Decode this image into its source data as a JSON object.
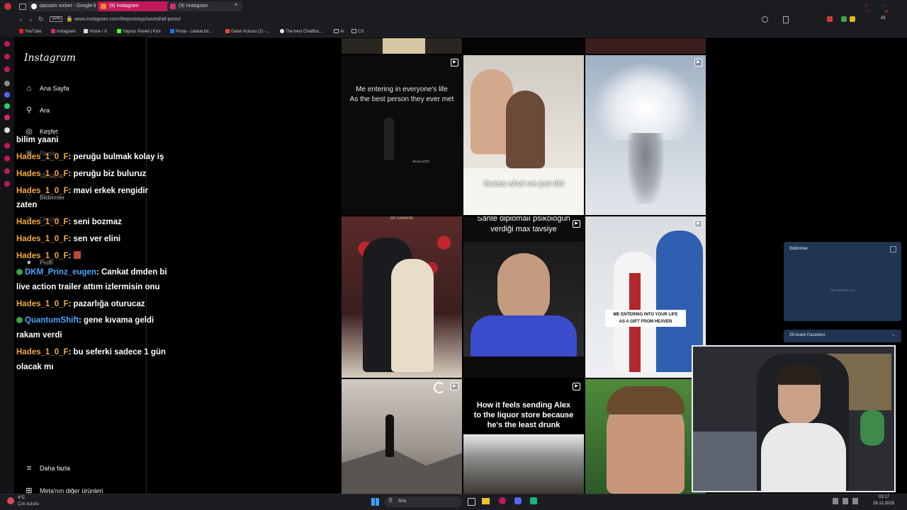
{
  "browser": {
    "tabs": [
      {
        "label": "qassam rocket - Google'd"
      },
      {
        "label": "(9) Instagram"
      },
      {
        "label": "(9) Instagram"
      }
    ],
    "vpn_label": "VPN",
    "url": "www.instagram.com/theprototyp/saved/all-posts/",
    "bookmarks": [
      {
        "label": "YouTube"
      },
      {
        "label": "Instagram"
      },
      {
        "label": "Home / X"
      },
      {
        "label": "Yayıncı Paneli | Kick"
      },
      {
        "label": "Posta - cankat bil..."
      },
      {
        "label": "Gelen Kutusu (2) -..."
      },
      {
        "label": "The best ChatBot..."
      },
      {
        "label": "AI"
      },
      {
        "label": "CS"
      }
    ]
  },
  "instagram": {
    "logo": "Instagram",
    "nav": [
      {
        "label": "Ana Sayfa",
        "icon": "home-icon"
      },
      {
        "label": "Ara",
        "icon": "search-icon"
      },
      {
        "label": "Keşfet",
        "icon": "compass-icon"
      },
      {
        "label": "Reels",
        "icon": "reels-icon"
      },
      {
        "label": "Mesajlar",
        "icon": "messenger-icon"
      },
      {
        "label": "Bildirimler",
        "icon": "heart-icon"
      },
      {
        "label": "Oluştur",
        "icon": "plus-icon"
      },
      {
        "label": "Profil",
        "icon": "avatar-icon"
      }
    ],
    "more_label": "Daha fazla",
    "meta_label": "Meta'nın diğer ürünleri"
  },
  "chat": [
    {
      "user": "",
      "text": "bilim yaani"
    },
    {
      "user": "Hades_1_0_F",
      "text": ": peruğu bulmak kolay iş"
    },
    {
      "user": "Hades_1_0_F",
      "text": ": peruğu biz buluruz"
    },
    {
      "user": "Hades_1_0_F",
      "text": ": mavi erkek rengidir"
    },
    {
      "user": "",
      "text": "zaten"
    },
    {
      "user": "Hades_1_0_F",
      "text": ": seni bozmaz"
    },
    {
      "user": "Hades_1_0_F",
      "text": ": sen ver elini"
    },
    {
      "user": "Hades_1_0_F",
      "text": ":"
    },
    {
      "user": "DKM_Prinz_eugen",
      "text": ": Cankat dmden bi"
    },
    {
      "user": "",
      "text": "live action trailer attım izlermisin onu"
    },
    {
      "user": "Hades_1_0_F",
      "text": ": pazarlığa oturucaz"
    },
    {
      "user": "QuantumShift",
      "text": ": gene kıvama geldi"
    },
    {
      "user": "",
      "text": "rakam verdi"
    },
    {
      "user": "Hades_1_0_F",
      "text": ": bu seferki sadece 1 gün"
    },
    {
      "user": "",
      "text": "olacak mı"
    }
  ],
  "grid": {
    "captions": {
      "p1_line1": "Me entering in everyone's life",
      "p1_line2": "As the best person they ever met",
      "p1_watermark": "Akrarul353",
      "p2": "Guess what we just did",
      "p4_top": "SIR GAWAINE",
      "p5_line1": "Sahte diplomalı psikoloğun",
      "p5_line2": "verdiği max tavsiye",
      "p6_line1": "ME ENTERING INTO YOUR LIFE",
      "p6_line2": "AS A GIFT FROM HEAVEN",
      "p8_line1": "How it feels sending Alex",
      "p8_line2": "to the liquor store because",
      "p8_line3": "he's the least drunk"
    }
  },
  "windows_panel": {
    "notifications_title": "Bildirimler",
    "no_notifications": "Yeni bildirim yok",
    "date": "29 Aralık Pazartesi"
  },
  "taskbar": {
    "weather_temp": "4°C",
    "weather_desc": "Çok bulutlu",
    "search_label": "Ara",
    "time": "03:17",
    "date": "29.12.2025"
  }
}
